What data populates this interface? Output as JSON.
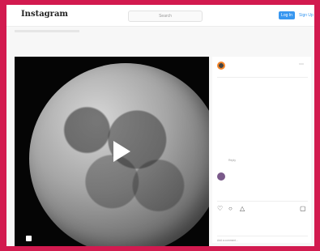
{
  "header": {
    "logo": "Instagram",
    "search_placeholder": "Search",
    "login_label": "Log In",
    "signup_label": "Sign Up"
  },
  "post": {
    "account": "",
    "location": "",
    "caption": "",
    "reply_label": "Reply",
    "comment": "",
    "comment_meta": "",
    "likes": "",
    "time": "",
    "add_comment": "Add a comment..."
  },
  "icons": {
    "heart": "heart-icon",
    "comment": "comment-icon",
    "share": "share-icon",
    "save": "bookmark-icon",
    "play": "play-icon",
    "volume": "volume-icon",
    "more": "more-icon"
  }
}
